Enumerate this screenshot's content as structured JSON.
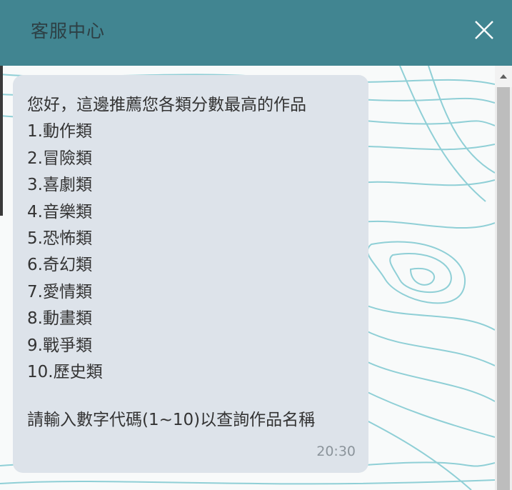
{
  "header": {
    "title": "客服中心"
  },
  "message": {
    "lines": [
      "您好，這邊推薦您各類分數最高的作品",
      "1.動作類",
      "2.冒險類",
      "3.喜劇類",
      "4.音樂類",
      "5.恐怖類",
      "6.奇幻類",
      "7.愛情類",
      "8.動畫類",
      "9.戰爭類",
      "10.歷史類"
    ],
    "prompt": "請輸入數字代碼(1~10)以查詢作品名稱",
    "time": "20:30"
  },
  "colors": {
    "header_bg": "#418591",
    "bubble_bg": "#dde3ea",
    "contour": "#8fcfd6"
  },
  "icons": {
    "close": "close-icon",
    "scroll_up": "chevron-up-icon"
  }
}
